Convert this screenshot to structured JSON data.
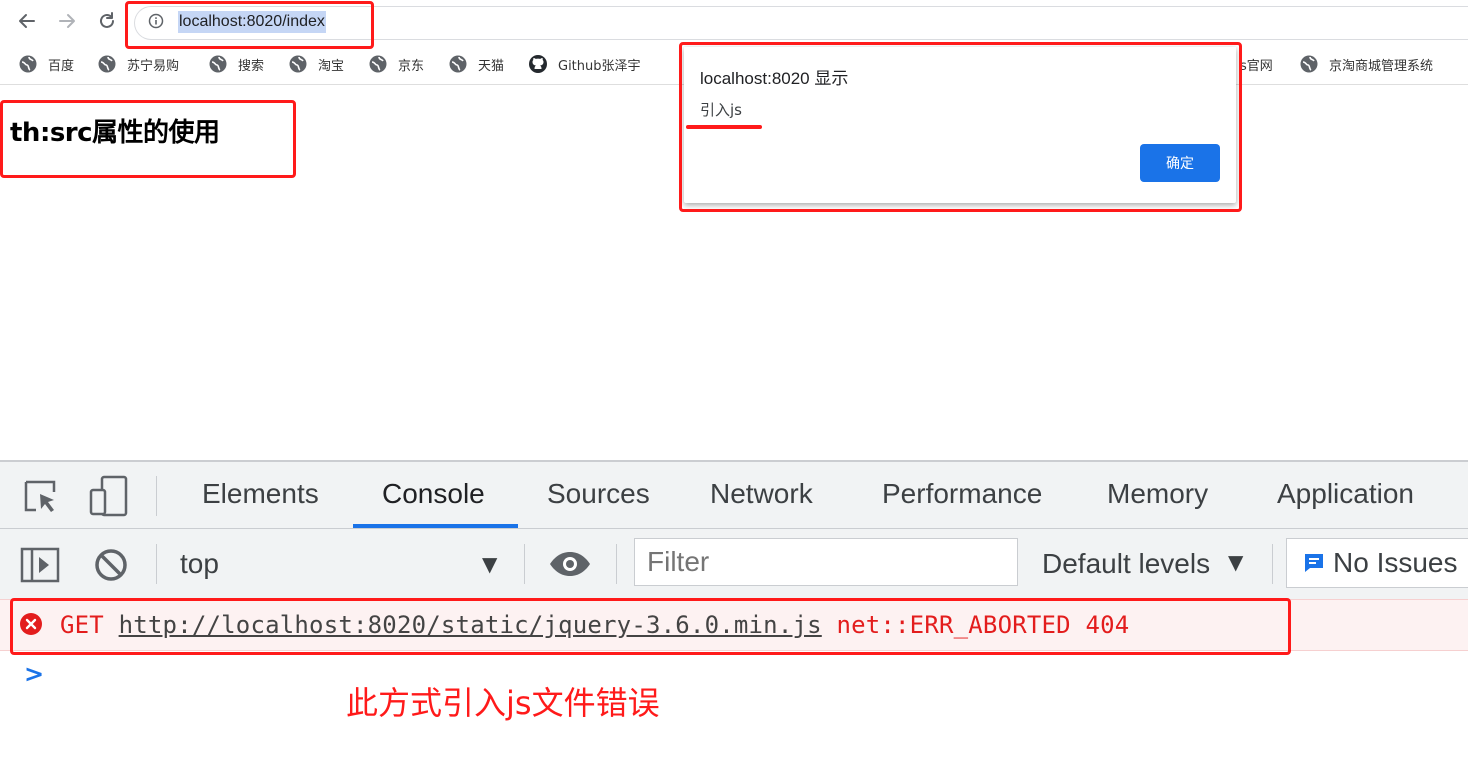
{
  "browser": {
    "url": "localhost:8020/index"
  },
  "bookmarks": [
    {
      "label": "百度"
    },
    {
      "label": "苏宁易购"
    },
    {
      "label": "搜索"
    },
    {
      "label": "淘宝"
    },
    {
      "label": "京东"
    },
    {
      "label": "天猫"
    },
    {
      "label": "Github张泽宇"
    },
    {
      "label": "s官网"
    },
    {
      "label": "京淘商城管理系统"
    }
  ],
  "page": {
    "heading": "th:src属性的使用"
  },
  "alert": {
    "title": "localhost:8020 显示",
    "message": "引入js",
    "ok_label": "确定",
    "button_color": "#1a73e8"
  },
  "devtools": {
    "tabs": [
      "Elements",
      "Console",
      "Sources",
      "Network",
      "Performance",
      "Memory",
      "Application"
    ],
    "active_tab": "Console",
    "context": "top",
    "filter_placeholder": "Filter",
    "levels_label": "Default levels",
    "issues_label": "No Issues"
  },
  "console": {
    "error": {
      "method": "GET",
      "url": "http://localhost:8020/static/jquery-3.6.0.min.js",
      "status": "net::ERR_ABORTED 404",
      "color": "#e31d1d"
    }
  },
  "annotation": "此方式引入js文件错误",
  "annotation_color": "#ff1a1a"
}
